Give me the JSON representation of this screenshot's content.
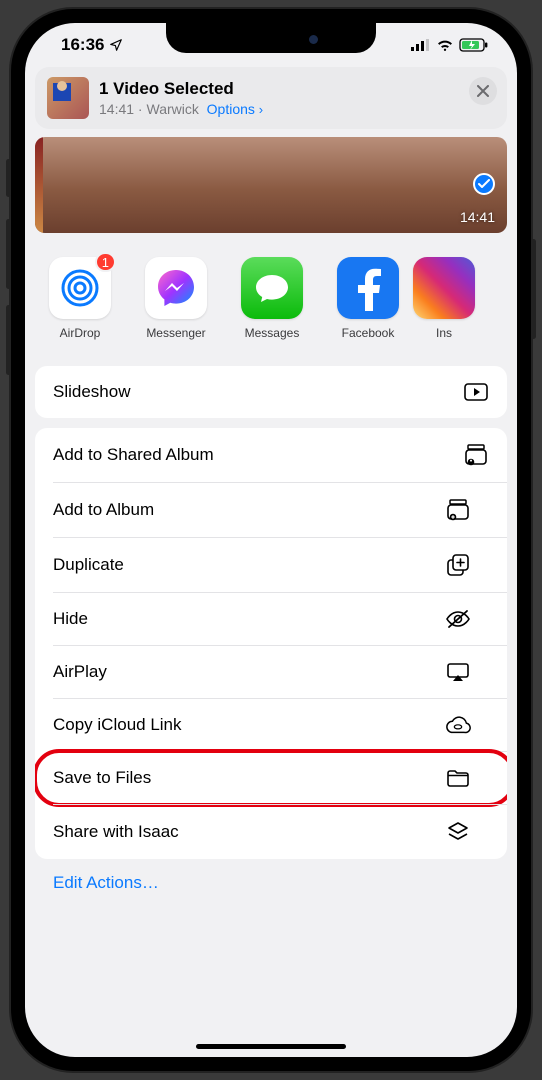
{
  "status": {
    "time": "16:36"
  },
  "header": {
    "title": "1 Video Selected",
    "subtitle_time": "14:41",
    "subtitle_location": "Warwick",
    "options_label": "Options"
  },
  "preview": {
    "duration": "14:41"
  },
  "apps": [
    {
      "name": "airdrop",
      "label": "AirDrop",
      "badge": "1"
    },
    {
      "name": "messenger",
      "label": "Messenger"
    },
    {
      "name": "messages",
      "label": "Messages"
    },
    {
      "name": "facebook",
      "label": "Facebook"
    },
    {
      "name": "instagram",
      "label": "Ins"
    }
  ],
  "sections": {
    "slideshow": "Slideshow",
    "actions": [
      {
        "id": "shared-album",
        "label": "Add to Shared Album",
        "icon": "shared-album-icon"
      },
      {
        "id": "add-album",
        "label": "Add to Album",
        "icon": "add-album-icon"
      },
      {
        "id": "duplicate",
        "label": "Duplicate",
        "icon": "duplicate-icon"
      },
      {
        "id": "hide",
        "label": "Hide",
        "icon": "hide-icon"
      },
      {
        "id": "airplay",
        "label": "AirPlay",
        "icon": "airplay-icon"
      },
      {
        "id": "icloud-link",
        "label": "Copy iCloud Link",
        "icon": "cloud-link-icon"
      },
      {
        "id": "save-files",
        "label": "Save to Files",
        "icon": "folder-icon",
        "highlighted": true
      },
      {
        "id": "share-isaac",
        "label": "Share with Isaac",
        "icon": "layers-icon"
      }
    ],
    "edit_actions": "Edit Actions…"
  }
}
